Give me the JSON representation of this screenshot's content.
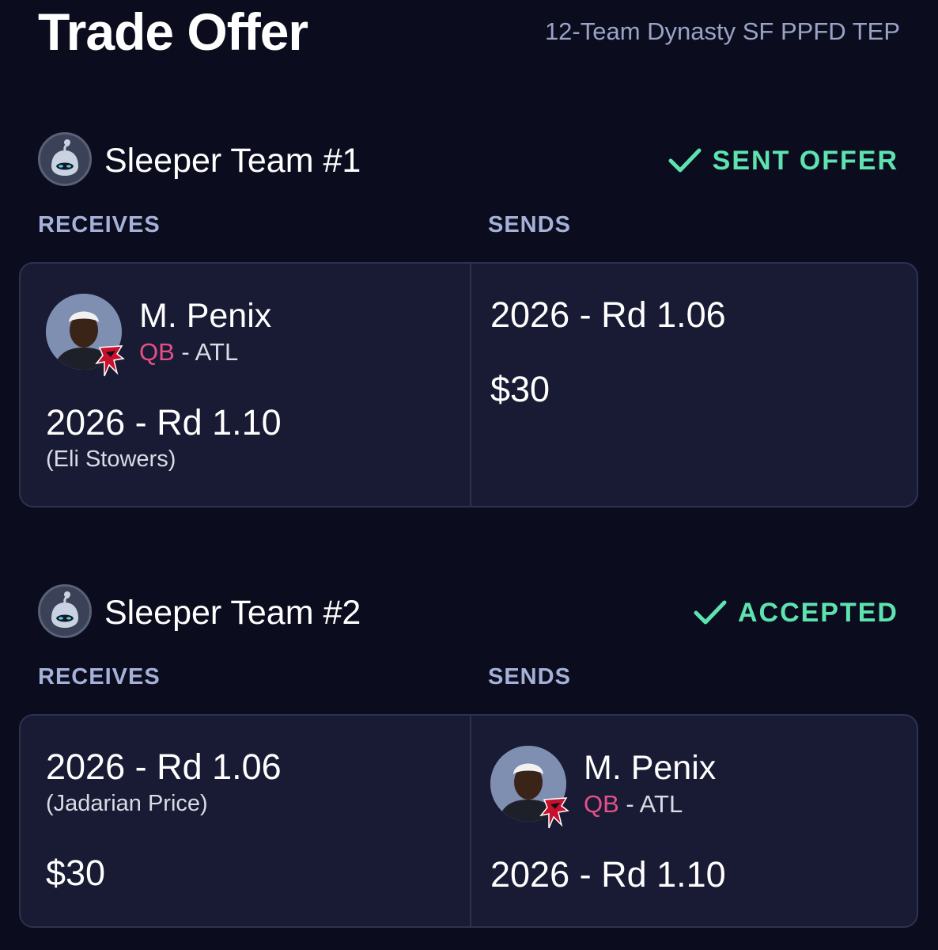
{
  "header": {
    "title": "Trade Offer",
    "league": "12-Team Dynasty SF PPFD TEP"
  },
  "teams": [
    {
      "name": "Sleeper Team #1",
      "status": "SENT OFFER",
      "receives_label": "RECEIVES",
      "sends_label": "SENDS",
      "receives": {
        "player": {
          "name": "M. Penix",
          "position": "QB",
          "team_sep": " - ATL"
        },
        "pick": "2026 - Rd 1.10",
        "pick_note": "(Eli Stowers)"
      },
      "sends": {
        "pick": "2026 - Rd 1.06",
        "money": "$30"
      }
    },
    {
      "name": "Sleeper Team #2",
      "status": "ACCEPTED",
      "receives_label": "RECEIVES",
      "sends_label": "SENDS",
      "receives": {
        "pick": "2026 - Rd 1.06",
        "pick_note": "(Jadarian Price)",
        "money": "$30"
      },
      "sends": {
        "player": {
          "name": "M. Penix",
          "position": "QB",
          "team_sep": " - ATL"
        },
        "pick": "2026 - Rd 1.10"
      }
    }
  ],
  "colors": {
    "background": "#0b0d1e",
    "card": "#181b33",
    "status": "#5ee3b0",
    "position": "#e5508a",
    "label": "#a5b1d8"
  },
  "icons": [
    "sleeper-avatar-icon",
    "check-icon",
    "player-headshot",
    "falcons-logo-icon"
  ]
}
